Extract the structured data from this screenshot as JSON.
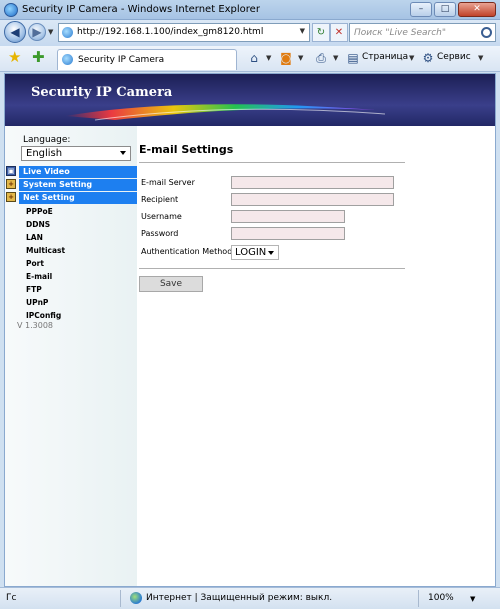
{
  "window": {
    "title": "Security IP Camera - Windows Internet Explorer",
    "minimize": "–",
    "maximize": "□",
    "close": "✕"
  },
  "address": {
    "url": "http://192.168.1.100/index_gm8120.html",
    "search_placeholder": "Поиск \"Live Search\""
  },
  "toolbar": {
    "tab_title": "Security IP Camera",
    "page_menu": "Страница",
    "tools_menu": "Сервис"
  },
  "banner": {
    "brand": "Security IP Camera"
  },
  "sidebar": {
    "language_label": "Language:",
    "language_value": "English",
    "menus": [
      {
        "label": "Live Video"
      },
      {
        "label": "System Setting"
      },
      {
        "label": "Net Setting"
      }
    ],
    "net_items": [
      "PPPoE",
      "DDNS",
      "LAN",
      "Multicast",
      "Port",
      "E-mail",
      "FTP",
      "UPnP",
      "IPConfig"
    ],
    "version": "V 1.3008"
  },
  "email": {
    "heading": "E-mail Settings",
    "server_label": "E-mail Server",
    "server_value": "",
    "recipient_label": "Recipient",
    "recipient_value": "",
    "username_label": "Username",
    "username_value": "",
    "password_label": "Password",
    "password_value": "",
    "auth_label": "Authentication Method",
    "auth_value": "LOGIN",
    "save_label": "Save"
  },
  "status": {
    "ready": "Гс",
    "zone": "Интернет | Защищенный режим: выкл.",
    "zoom": "100%"
  },
  "colors": {
    "menu_blue": "#1d7ff0",
    "input_pink": "#f5e8ea",
    "banner_navy": "#1c1f55"
  }
}
